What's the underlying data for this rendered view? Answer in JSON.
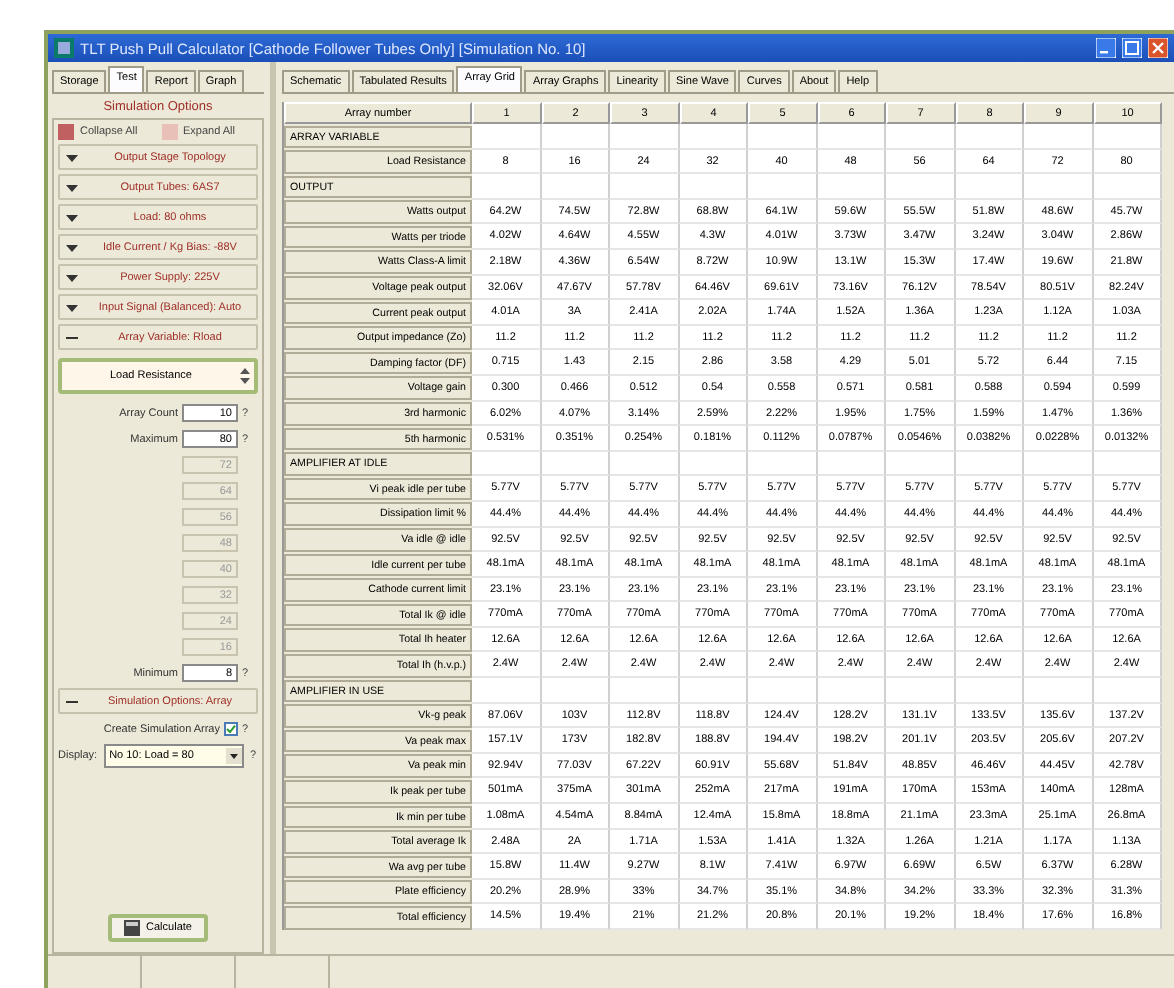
{
  "window": {
    "title": "TLT Push Pull Calculator [Cathode Follower Tubes Only] [Simulation No. 10]"
  },
  "left_tabs": [
    {
      "label": "Storage",
      "selected": false
    },
    {
      "label": "Test",
      "selected": true
    },
    {
      "label": "Report",
      "selected": false
    },
    {
      "label": "Graph",
      "selected": false
    }
  ],
  "panel": {
    "title": "Simulation Options",
    "collapse_all": "Collapse All",
    "expand_all": "Expand All",
    "sections": [
      {
        "label": "Output Stage Topology",
        "expanded": false
      },
      {
        "label": "Output Tubes: 6AS7",
        "expanded": false
      },
      {
        "label": "Load: 80 ohms",
        "expanded": false
      },
      {
        "label": "Idle Current / Kg Bias: -88V",
        "expanded": false
      },
      {
        "label": "Power Supply: 225V",
        "expanded": false
      },
      {
        "label": "Input Signal (Balanced): Auto",
        "expanded": false
      },
      {
        "label": "Array Variable: Rload",
        "expanded": true
      }
    ],
    "array_variable": "Load Resistance",
    "array_count": {
      "label": "Array Count",
      "value": "10",
      "help": "?"
    },
    "maximum": {
      "label": "Maximum",
      "value": "80",
      "help": "?"
    },
    "steps": [
      "72",
      "64",
      "56",
      "48",
      "40",
      "32",
      "24",
      "16"
    ],
    "minimum": {
      "label": "Minimum",
      "value": "8",
      "help": "?"
    },
    "array_section": {
      "label": "Simulation Options: Array",
      "expanded": true
    },
    "create_array": {
      "label": "Create Simulation Array",
      "checked": true,
      "help": "?"
    },
    "display": {
      "label": "Display:",
      "value": "No 10: Load = 80",
      "help": "?"
    },
    "calculate": "Calculate"
  },
  "tabs": [
    {
      "label": "Schematic",
      "selected": false
    },
    {
      "label": "Tabulated Results",
      "selected": false
    },
    {
      "label": "Array Grid",
      "selected": true
    },
    {
      "label": "Array Graphs",
      "selected": false
    },
    {
      "label": "Linearity",
      "selected": false
    },
    {
      "label": "Sine Wave",
      "selected": false
    },
    {
      "label": "Curves",
      "selected": false
    },
    {
      "label": "About",
      "selected": false
    },
    {
      "label": "Help",
      "selected": false
    }
  ],
  "grid": {
    "header": "Array number",
    "columns": [
      "1",
      "2",
      "3",
      "4",
      "5",
      "6",
      "7",
      "8",
      "9",
      "10"
    ],
    "rows": [
      {
        "kind": "section",
        "label": "ARRAY VARIABLE"
      },
      {
        "kind": "data",
        "label": "Load Resistance",
        "values": [
          "8",
          "16",
          "24",
          "32",
          "40",
          "48",
          "56",
          "64",
          "72",
          "80"
        ]
      },
      {
        "kind": "section",
        "label": "OUTPUT"
      },
      {
        "kind": "data",
        "label": "Watts output",
        "values": [
          "64.2W",
          "74.5W",
          "72.8W",
          "68.8W",
          "64.1W",
          "59.6W",
          "55.5W",
          "51.8W",
          "48.6W",
          "45.7W"
        ]
      },
      {
        "kind": "data",
        "label": "Watts per triode",
        "values": [
          "4.02W",
          "4.64W",
          "4.55W",
          "4.3W",
          "4.01W",
          "3.73W",
          "3.47W",
          "3.24W",
          "3.04W",
          "2.86W"
        ]
      },
      {
        "kind": "data",
        "label": "Watts Class-A limit",
        "values": [
          "2.18W",
          "4.36W",
          "6.54W",
          "8.72W",
          "10.9W",
          "13.1W",
          "15.3W",
          "17.4W",
          "19.6W",
          "21.8W"
        ]
      },
      {
        "kind": "data",
        "label": "Voltage peak output",
        "values": [
          "32.06V",
          "47.67V",
          "57.78V",
          "64.46V",
          "69.61V",
          "73.16V",
          "76.12V",
          "78.54V",
          "80.51V",
          "82.24V"
        ]
      },
      {
        "kind": "data",
        "label": "Current peak output",
        "values": [
          "4.01A",
          "3A",
          "2.41A",
          "2.02A",
          "1.74A",
          "1.52A",
          "1.36A",
          "1.23A",
          "1.12A",
          "1.03A"
        ]
      },
      {
        "kind": "data",
        "label": "Output impedance (Zo)",
        "values": [
          "11.2",
          "11.2",
          "11.2",
          "11.2",
          "11.2",
          "11.2",
          "11.2",
          "11.2",
          "11.2",
          "11.2"
        ]
      },
      {
        "kind": "data",
        "label": "Damping factor (DF)",
        "values": [
          "0.715",
          "1.43",
          "2.15",
          "2.86",
          "3.58",
          "4.29",
          "5.01",
          "5.72",
          "6.44",
          "7.15"
        ]
      },
      {
        "kind": "data",
        "label": "Voltage gain",
        "values": [
          "0.300",
          "0.466",
          "0.512",
          "0.54",
          "0.558",
          "0.571",
          "0.581",
          "0.588",
          "0.594",
          "0.599"
        ]
      },
      {
        "kind": "data",
        "label": "3rd harmonic",
        "values": [
          "6.02%",
          "4.07%",
          "3.14%",
          "2.59%",
          "2.22%",
          "1.95%",
          "1.75%",
          "1.59%",
          "1.47%",
          "1.36%"
        ]
      },
      {
        "kind": "data",
        "label": "5th harmonic",
        "values": [
          "0.531%",
          "0.351%",
          "0.254%",
          "0.181%",
          "0.112%",
          "0.0787%",
          "0.0546%",
          "0.0382%",
          "0.0228%",
          "0.0132%"
        ]
      },
      {
        "kind": "section",
        "label": "AMPLIFIER AT IDLE"
      },
      {
        "kind": "data",
        "label": "Vi peak idle per tube",
        "values": [
          "5.77V",
          "5.77V",
          "5.77V",
          "5.77V",
          "5.77V",
          "5.77V",
          "5.77V",
          "5.77V",
          "5.77V",
          "5.77V"
        ]
      },
      {
        "kind": "data",
        "label": "Dissipation limit %",
        "values": [
          "44.4%",
          "44.4%",
          "44.4%",
          "44.4%",
          "44.4%",
          "44.4%",
          "44.4%",
          "44.4%",
          "44.4%",
          "44.4%"
        ]
      },
      {
        "kind": "data",
        "label": "Va idle @ idle",
        "values": [
          "92.5V",
          "92.5V",
          "92.5V",
          "92.5V",
          "92.5V",
          "92.5V",
          "92.5V",
          "92.5V",
          "92.5V",
          "92.5V"
        ]
      },
      {
        "kind": "data",
        "label": "Idle current per tube",
        "values": [
          "48.1mA",
          "48.1mA",
          "48.1mA",
          "48.1mA",
          "48.1mA",
          "48.1mA",
          "48.1mA",
          "48.1mA",
          "48.1mA",
          "48.1mA"
        ]
      },
      {
        "kind": "data",
        "label": "Cathode current limit",
        "values": [
          "23.1%",
          "23.1%",
          "23.1%",
          "23.1%",
          "23.1%",
          "23.1%",
          "23.1%",
          "23.1%",
          "23.1%",
          "23.1%"
        ]
      },
      {
        "kind": "data",
        "label": "Total Ik @ idle",
        "values": [
          "770mA",
          "770mA",
          "770mA",
          "770mA",
          "770mA",
          "770mA",
          "770mA",
          "770mA",
          "770mA",
          "770mA"
        ]
      },
      {
        "kind": "data",
        "label": "Total Ih heater",
        "values": [
          "12.6A",
          "12.6A",
          "12.6A",
          "12.6A",
          "12.6A",
          "12.6A",
          "12.6A",
          "12.6A",
          "12.6A",
          "12.6A"
        ]
      },
      {
        "kind": "data",
        "label": "Total Ih (h.v.p.)",
        "values": [
          "2.4W",
          "2.4W",
          "2.4W",
          "2.4W",
          "2.4W",
          "2.4W",
          "2.4W",
          "2.4W",
          "2.4W",
          "2.4W"
        ]
      },
      {
        "kind": "section",
        "label": "AMPLIFIER IN USE"
      },
      {
        "kind": "data",
        "label": "Vk-g peak",
        "values": [
          "87.06V",
          "103V",
          "112.8V",
          "118.8V",
          "124.4V",
          "128.2V",
          "131.1V",
          "133.5V",
          "135.6V",
          "137.2V"
        ]
      },
      {
        "kind": "data",
        "label": "Va peak max",
        "values": [
          "157.1V",
          "173V",
          "182.8V",
          "188.8V",
          "194.4V",
          "198.2V",
          "201.1V",
          "203.5V",
          "205.6V",
          "207.2V"
        ]
      },
      {
        "kind": "data",
        "label": "Va peak min",
        "values": [
          "92.94V",
          "77.03V",
          "67.22V",
          "60.91V",
          "55.68V",
          "51.84V",
          "48.85V",
          "46.46V",
          "44.45V",
          "42.78V"
        ]
      },
      {
        "kind": "data",
        "label": "Ik peak per tube",
        "values": [
          "501mA",
          "375mA",
          "301mA",
          "252mA",
          "217mA",
          "191mA",
          "170mA",
          "153mA",
          "140mA",
          "128mA"
        ]
      },
      {
        "kind": "data",
        "label": "Ik min per tube",
        "values": [
          "1.08mA",
          "4.54mA",
          "8.84mA",
          "12.4mA",
          "15.8mA",
          "18.8mA",
          "21.1mA",
          "23.3mA",
          "25.1mA",
          "26.8mA"
        ]
      },
      {
        "kind": "data",
        "label": "Total average Ik",
        "values": [
          "2.48A",
          "2A",
          "1.71A",
          "1.53A",
          "1.41A",
          "1.32A",
          "1.26A",
          "1.21A",
          "1.17A",
          "1.13A"
        ]
      },
      {
        "kind": "data",
        "label": "Wa avg per tube",
        "values": [
          "15.8W",
          "11.4W",
          "9.27W",
          "8.1W",
          "7.41W",
          "6.97W",
          "6.69W",
          "6.5W",
          "6.37W",
          "6.28W"
        ]
      },
      {
        "kind": "data",
        "label": "Plate efficiency",
        "values": [
          "20.2%",
          "28.9%",
          "33%",
          "34.7%",
          "35.1%",
          "34.8%",
          "34.2%",
          "33.3%",
          "32.3%",
          "31.3%"
        ]
      },
      {
        "kind": "data",
        "label": "Total efficiency",
        "values": [
          "14.5%",
          "19.4%",
          "21%",
          "21.2%",
          "20.8%",
          "20.1%",
          "19.2%",
          "18.4%",
          "17.6%",
          "16.8%"
        ]
      }
    ]
  }
}
